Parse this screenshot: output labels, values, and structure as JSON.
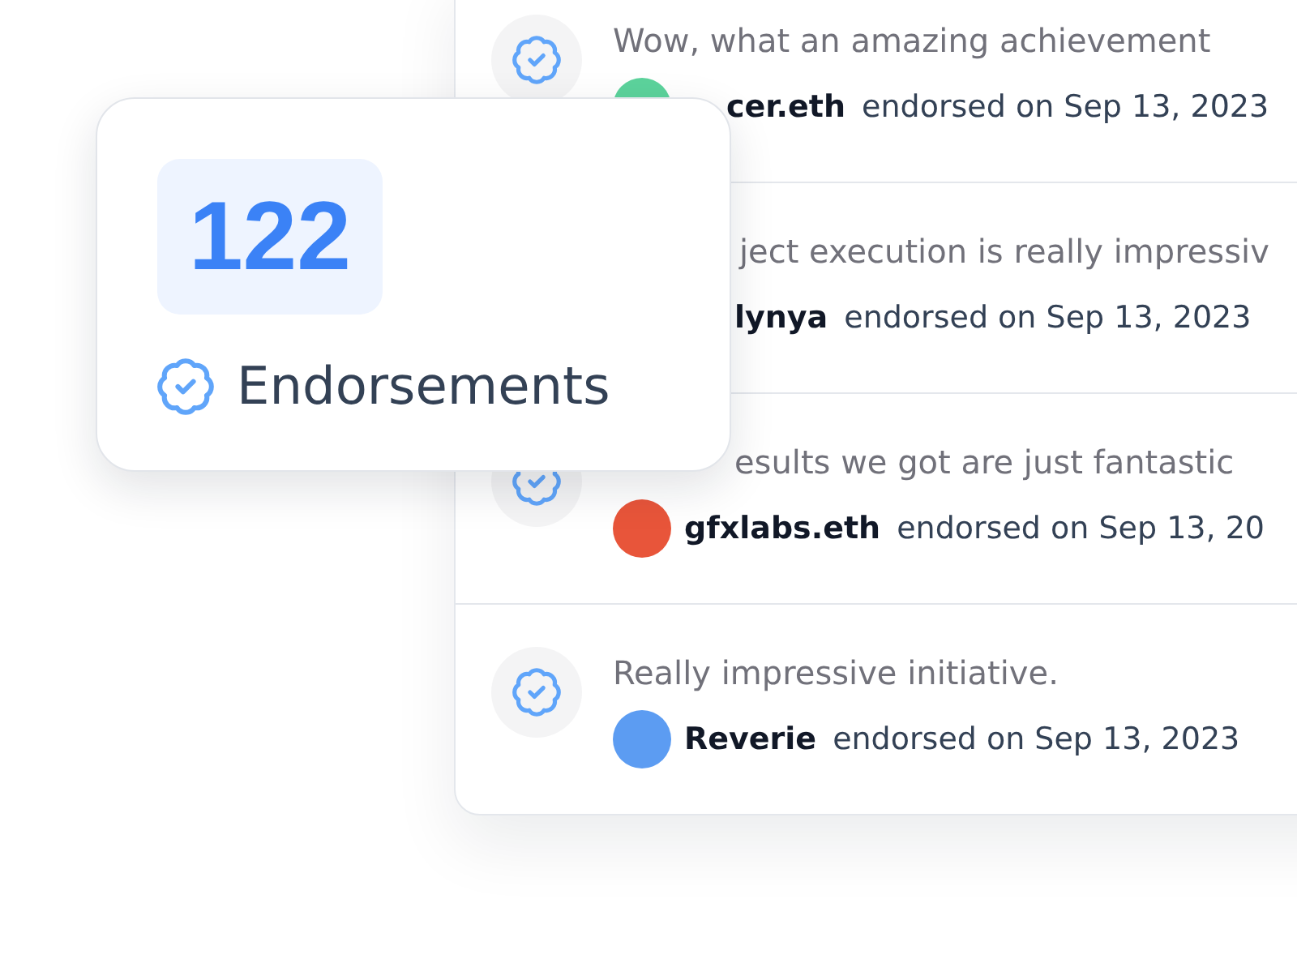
{
  "endorsements": {
    "items": [
      {
        "comment": "Wow, what an amazing achievement",
        "author": "cer.eth",
        "color": "#5cd39c",
        "endorsed": "endorsed on Sep 13, 2023"
      },
      {
        "comment": "ject execution is really impressiv",
        "author": "lynya",
        "endorsed": "endorsed on Sep 13, 2023"
      },
      {
        "comment": "esults we got are just fantastic",
        "author": "gfxlabs.eth",
        "color": "#e8553a",
        "endorsed": "endorsed on Sep 13, 20"
      },
      {
        "comment": "Really impressive initiative.",
        "author": "Reverie",
        "color": "#5c9cf2",
        "endorsed": "endorsed on Sep 13, 2023"
      }
    ]
  },
  "summary_card": {
    "count": "122",
    "label": "Endorsements"
  }
}
